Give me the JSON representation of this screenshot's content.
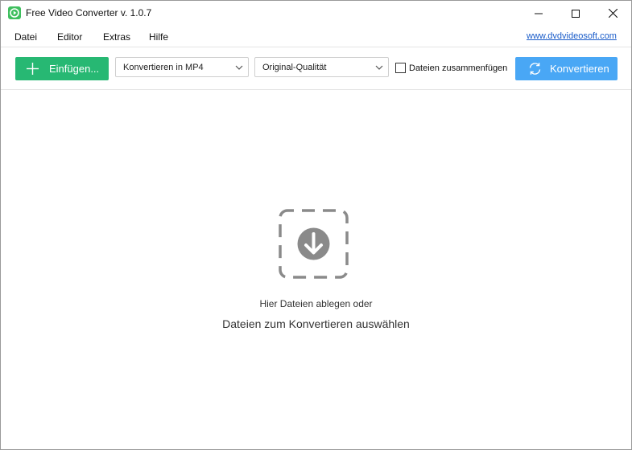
{
  "window": {
    "title": "Free Video Converter v. 1.0.7"
  },
  "menu": {
    "items": [
      "Datei",
      "Editor",
      "Extras",
      "Hilfe"
    ],
    "link": "www.dvdvideosoft.com"
  },
  "toolbar": {
    "add_label": "Einfügen...",
    "format_value": "Konvertieren in MP4",
    "quality_value": "Original-Qualität",
    "merge_label": "Dateien zusammenfügen",
    "merge_checked": false,
    "convert_label": "Konvertieren"
  },
  "drop_area": {
    "hint": "Hier Dateien ablegen oder",
    "action": "Dateien zum Konvertieren auswählen"
  },
  "colors": {
    "add_button": "#27b873",
    "convert_button": "#49a7f5",
    "link": "#1a5cc9",
    "drop_icon": "#8a8a8a"
  }
}
